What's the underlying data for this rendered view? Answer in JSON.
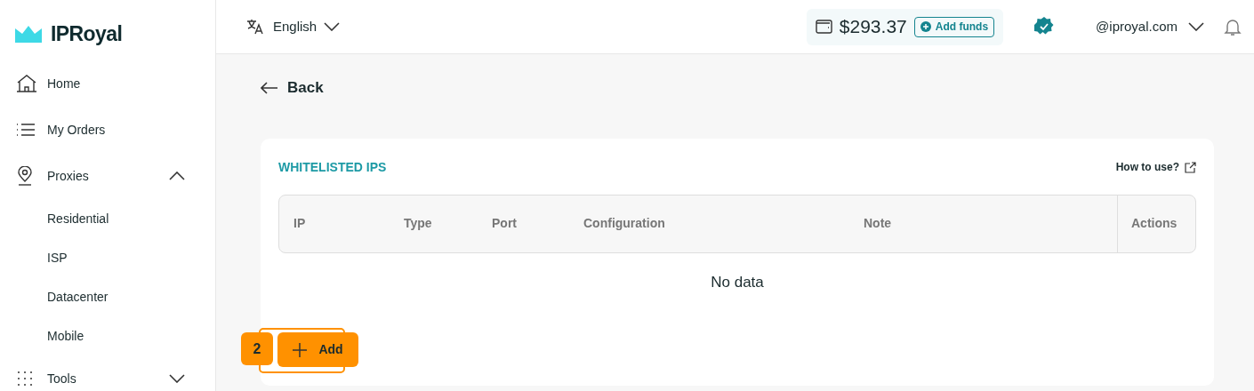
{
  "logo": {
    "text": "IPRoyal"
  },
  "sidebar": {
    "items": [
      {
        "label": "Home"
      },
      {
        "label": "My Orders"
      },
      {
        "label": "Proxies",
        "expanded": true,
        "children": [
          {
            "label": "Residential"
          },
          {
            "label": "ISP"
          },
          {
            "label": "Datacenter"
          },
          {
            "label": "Mobile"
          }
        ]
      },
      {
        "label": "Tools",
        "expanded": false
      }
    ]
  },
  "header": {
    "language": "English",
    "balance": "$293.37",
    "add_funds": "Add funds",
    "account": "@iproyal.com"
  },
  "back": "Back",
  "card": {
    "title": "WHITELISTED IPS",
    "help_link": "How to use?",
    "table": {
      "columns": [
        "IP",
        "Type",
        "Port",
        "Configuration",
        "Note",
        "Actions"
      ],
      "empty_text": "No data"
    },
    "add_button": "Add",
    "step_badge": "2"
  }
}
